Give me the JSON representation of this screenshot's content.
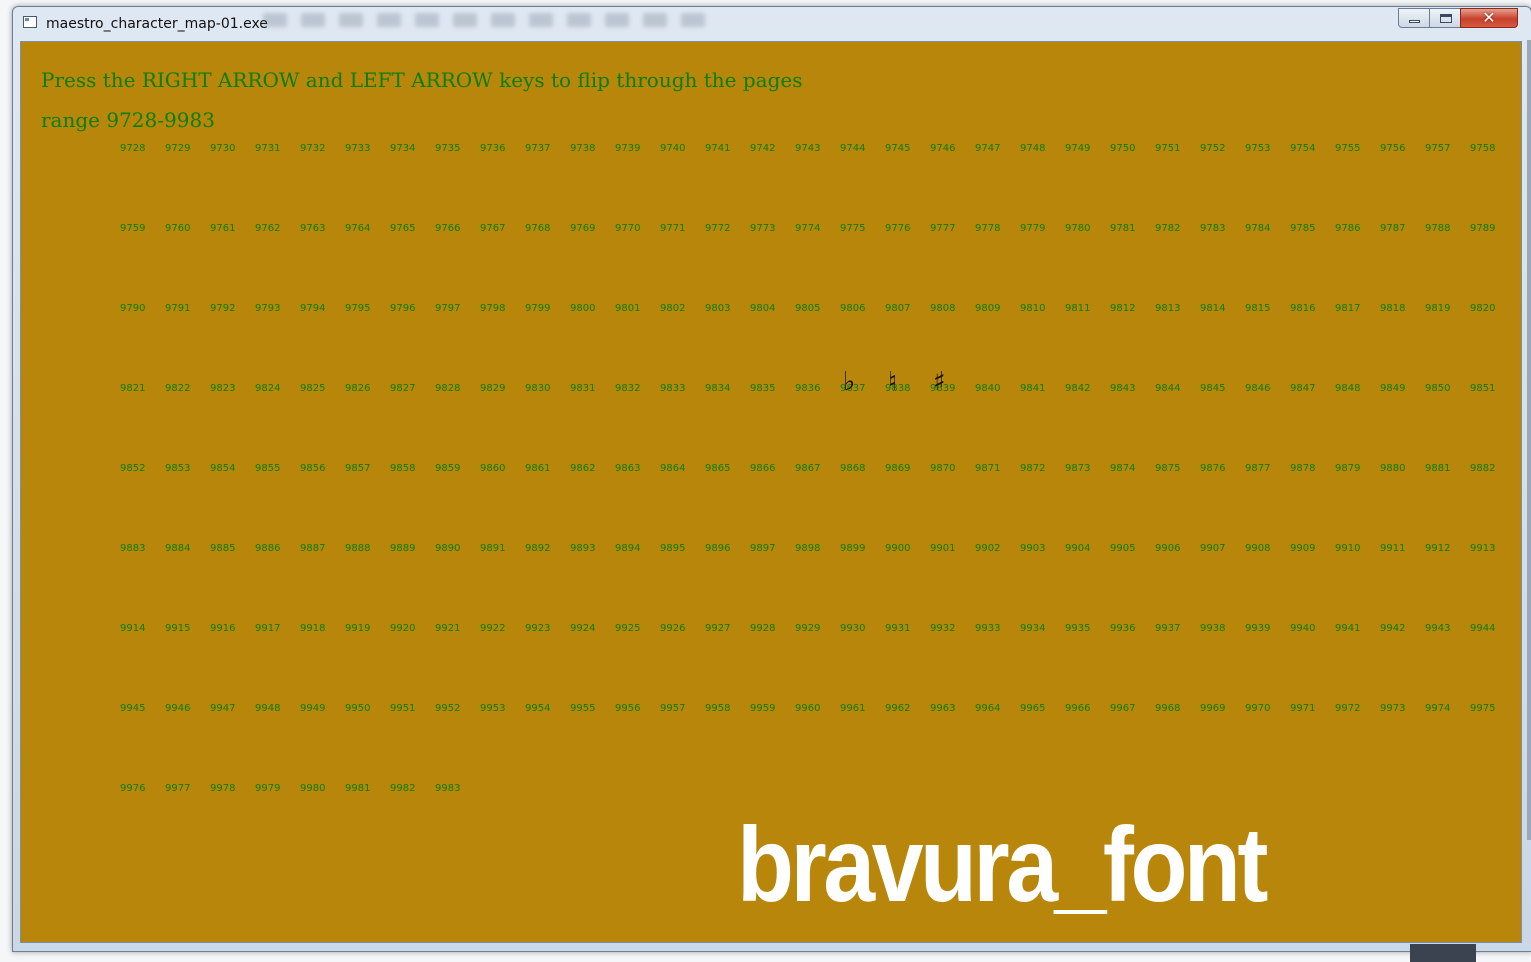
{
  "window": {
    "title": "maestro_character_map-01.exe",
    "close_glyph": "✕"
  },
  "content": {
    "instruction": "Press the RIGHT ARROW and LEFT ARROW keys to flip through the pages",
    "range_text": "range 9728-9983",
    "range_start": 9728,
    "range_end": 9983,
    "columns_per_row": 31,
    "glyphs": [
      {
        "code": 9837,
        "char": "♭",
        "icon": "music-flat-sign"
      },
      {
        "code": 9838,
        "char": "♮",
        "icon": "music-natural-sign"
      },
      {
        "code": 9839,
        "char": "♯",
        "icon": "music-sharp-sign"
      }
    ],
    "brand": "bravura_font"
  },
  "colors": {
    "background": "#b8860b",
    "text": "#0a7f0a",
    "glyph": "#111111",
    "brand": "#ffffff"
  }
}
